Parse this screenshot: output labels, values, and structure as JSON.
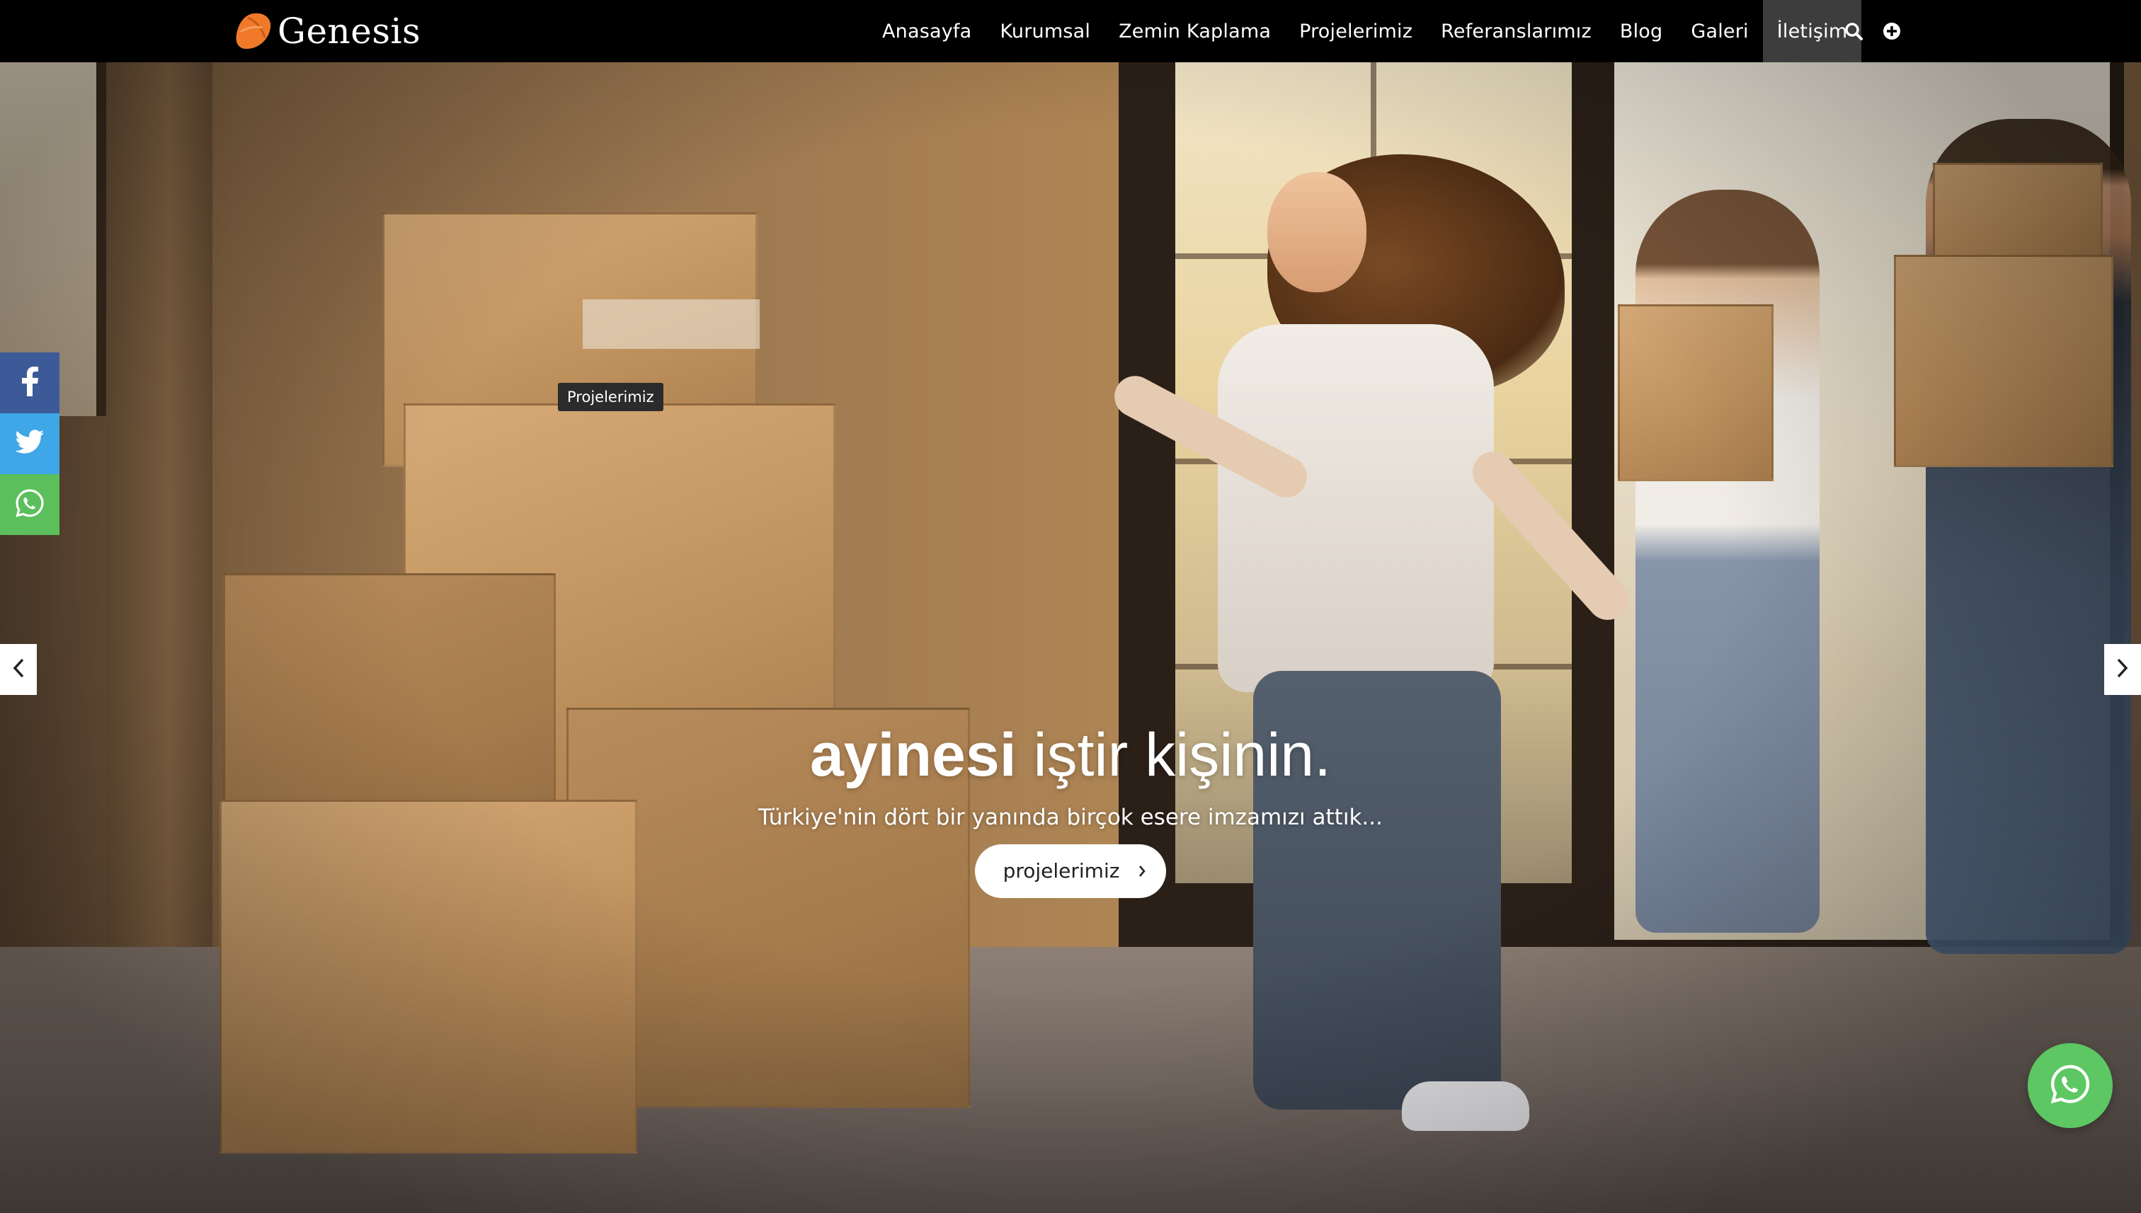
{
  "brand": {
    "name": "Genesis",
    "logo_icon": "orange-leaf-icon",
    "logo_color": "#f07a2a"
  },
  "nav": {
    "items": [
      {
        "label": "Anasayfa"
      },
      {
        "label": "Kurumsal"
      },
      {
        "label": "Zemin Kaplama"
      },
      {
        "label": "Projelerimiz"
      },
      {
        "label": "Referanslarımız"
      },
      {
        "label": "Blog"
      },
      {
        "label": "Galeri"
      },
      {
        "label": "İletişim",
        "active": true
      }
    ],
    "icons": [
      "search-icon",
      "plus-circle-icon"
    ]
  },
  "social": {
    "items": [
      "facebook-icon",
      "twitter-icon",
      "whatsapp-icon"
    ],
    "colors": [
      "#3d5a98",
      "#3fa7e8",
      "#5bbf5b"
    ]
  },
  "tooltip": {
    "text": "Projelerimiz"
  },
  "slide": {
    "headline_bold": "ayinesi",
    "headline_light": "iştir kişinin.",
    "subline": "Türkiye'nin dört bir yanında birçok esere imzamızı attık...",
    "cta_label": "projelerimiz"
  },
  "fab": {
    "icon": "whatsapp-icon",
    "color": "#5cc763"
  }
}
